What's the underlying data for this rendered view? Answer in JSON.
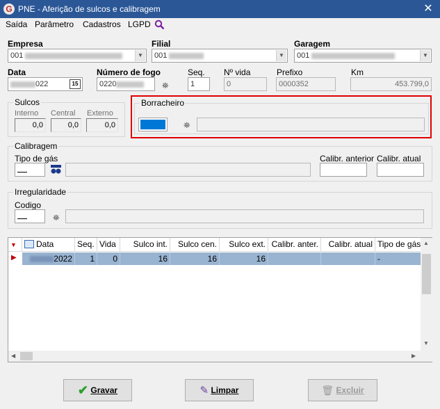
{
  "window": {
    "title": "PNE - Aferição de sulcos e calibragem",
    "close_glyph": "✕",
    "logo_letter": "G"
  },
  "menu": {
    "items": [
      "Saída",
      "Parâmetro",
      "Cadastros",
      "LGPD"
    ]
  },
  "form": {
    "empresa": {
      "label": "Empresa",
      "value": "001"
    },
    "filial": {
      "label": "Filial",
      "value": "001"
    },
    "garagem": {
      "label": "Garagem",
      "value": "001"
    },
    "data": {
      "label": "Data",
      "value": "022",
      "cal_day": "15"
    },
    "numero_fogo": {
      "label": "Número de fogo",
      "value": "0220"
    },
    "seq": {
      "label": "Seq.",
      "value": "1"
    },
    "n_vida": {
      "label": "Nº vida",
      "value": "0"
    },
    "prefixo": {
      "label": "Prefixo",
      "value": "0000352"
    },
    "km": {
      "label": "Km",
      "value": "453.799,0"
    }
  },
  "sulcos": {
    "title": "Sulcos",
    "interno": {
      "label": "Interno",
      "value": "0,0"
    },
    "central": {
      "label": "Central",
      "value": "0,0"
    },
    "externo": {
      "label": "Externo",
      "value": "0,0"
    }
  },
  "borracheiro": {
    "title": "Borracheiro",
    "highlight_color": "#e00000",
    "selection_color": "#0078d7"
  },
  "calibragem": {
    "title": "Calibragem",
    "tipo_gas": {
      "label": "Tipo de gás"
    },
    "calibr_anterior": {
      "label": "Calibr. anterior"
    },
    "calibr_atual": {
      "label": "Calibr. atual"
    }
  },
  "irregularidade": {
    "title": "Irregularidade",
    "codigo": {
      "label": "Codigo"
    }
  },
  "grid": {
    "columns": [
      "Data",
      "Seq.",
      "Vida",
      "Sulco int.",
      "Sulco cen.",
      "Sulco ext.",
      "Calibr. anter.",
      "Calibr. atual",
      "Tipo de gás"
    ],
    "rows": [
      {
        "data": "2022",
        "seq": "1",
        "vida": "0",
        "sulco_int": "16",
        "sulco_cen": "16",
        "sulco_ext": "16",
        "calibr_anter": "",
        "calibr_atual": "",
        "tipo_gas": "-"
      }
    ],
    "row_highlight": "#99b4d1"
  },
  "buttons": {
    "gravar": {
      "label": "Gravar"
    },
    "limpar": {
      "label": "Limpar"
    },
    "excluir": {
      "label": "Excluir"
    }
  }
}
